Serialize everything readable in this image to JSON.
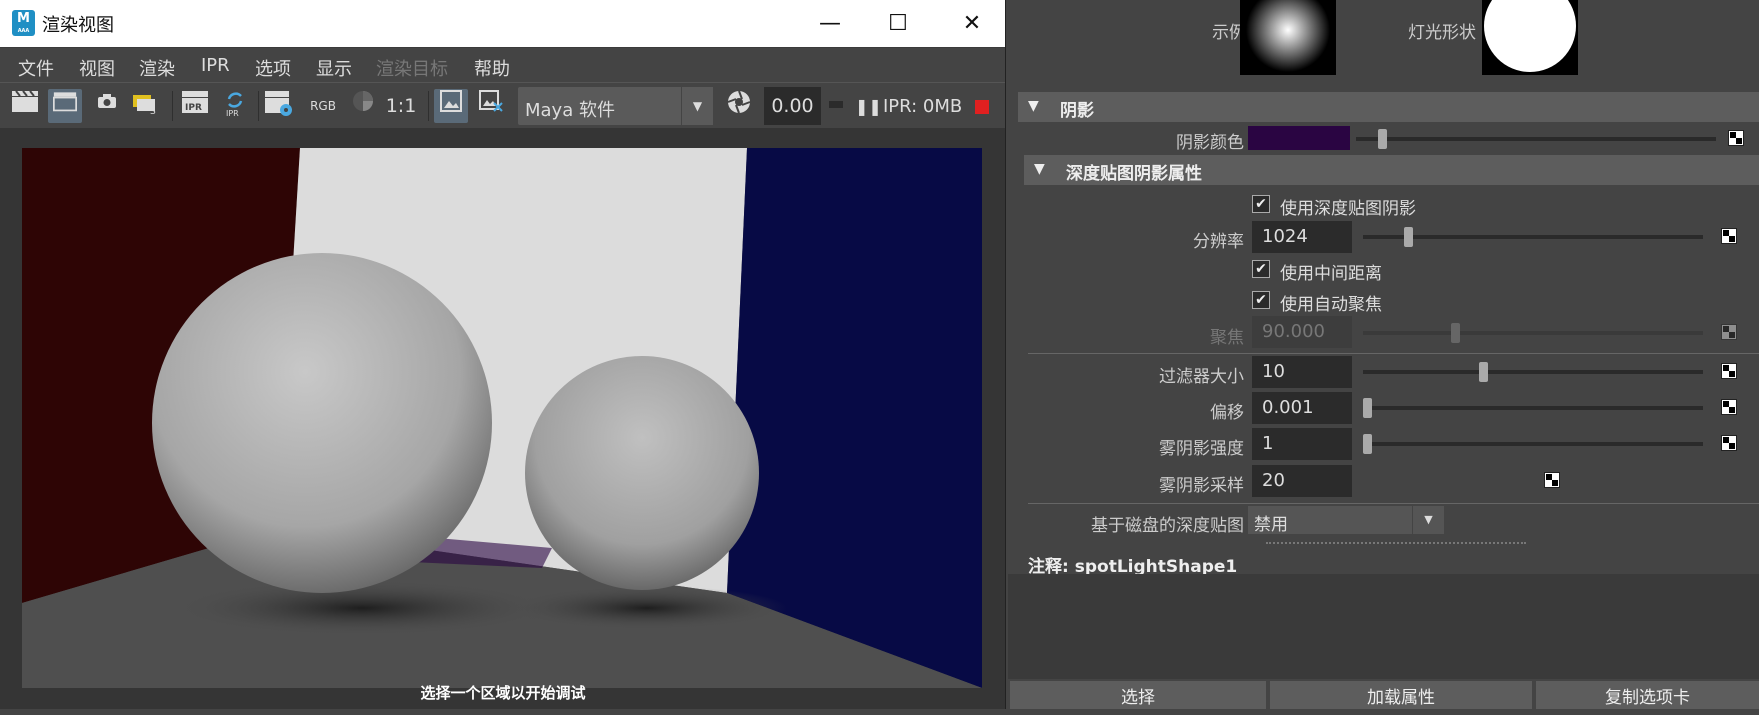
{
  "render_window": {
    "title": "渲染视图",
    "controls": {
      "minimize": "—",
      "maximize": "☐",
      "close": "✕"
    },
    "menus": [
      "文件",
      "视图",
      "渲染",
      "IPR",
      "选项",
      "显示",
      "渲染目标",
      "帮助"
    ],
    "toolbar": {
      "rgb_label": "RGB",
      "ratio_label": "1:1",
      "renderer": "Maya 软件",
      "time_value": "0.00",
      "ipr_status": "IPR: 0MB"
    },
    "status_hint": "选择一个区域以开始调试"
  },
  "attribute_editor": {
    "example_label": "示例",
    "light_shape_label": "灯光形状",
    "shadow_section": {
      "title": "阴影",
      "shadow_color_label": "阴影颜色",
      "shadow_color": "#2a0542",
      "shadow_color_slider": 0.06
    },
    "depth_map_section": {
      "title": "深度贴图阴影属性",
      "use_depth_map_label": "使用深度贴图阴影",
      "use_depth_map": true,
      "resolution_label": "分辨率",
      "resolution": "1024",
      "resolution_slider": 0.12,
      "use_mid_dist_label": "使用中间距离",
      "use_mid_dist": true,
      "use_auto_focus_label": "使用自动聚焦",
      "use_auto_focus": true,
      "focus_label": "聚焦",
      "focus": "90.000",
      "focus_slider": 0.26,
      "filter_size_label": "过滤器大小",
      "filter_size": "10",
      "filter_size_slider": 0.34,
      "bias_label": "偏移",
      "bias": "0.001",
      "fog_intensity_label": "雾阴影强度",
      "fog_intensity": "1",
      "fog_samples_label": "雾阴影采样",
      "fog_samples": "20",
      "disk_based_label": "基于磁盘的深度贴图",
      "disk_based": "禁用"
    },
    "notes_label": "注释:",
    "notes_object": "spotLightShape1",
    "buttons": [
      "选择",
      "加载属性",
      "复制选项卡"
    ]
  },
  "colors": {
    "accent_stop": "#e02020",
    "left_wall": "#2e0505",
    "right_wall": "#070a45",
    "back_wall": "#dcdcdc",
    "floor": "#4f4f4f"
  }
}
